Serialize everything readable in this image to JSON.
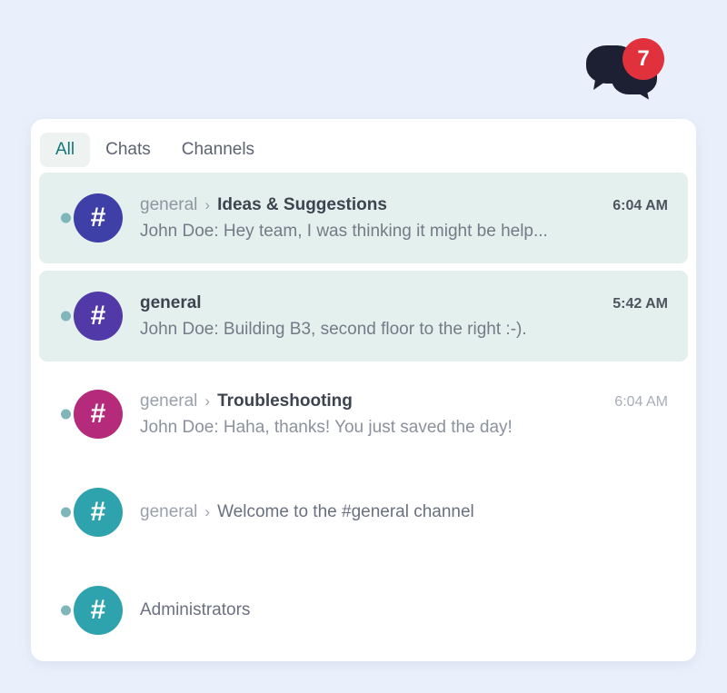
{
  "notification": {
    "icon": "chat-bubbles-icon",
    "badge_count": "7",
    "badge_color": "#e0313c",
    "icon_color": "#1d2033"
  },
  "tabs": [
    {
      "label": "All",
      "active": true
    },
    {
      "label": "Chats",
      "active": false
    },
    {
      "label": "Channels",
      "active": false
    }
  ],
  "rows": [
    {
      "avatar_glyph": "#",
      "avatar_color": "#3f3fa8",
      "unread": true,
      "highlighted": true,
      "parent": "general",
      "separator": "›",
      "title": "Ideas & Suggestions",
      "title_bold": true,
      "time": "6:04 AM",
      "preview": "John Doe: Hey team, I was thinking it might be help..."
    },
    {
      "avatar_glyph": "#",
      "avatar_color": "#5239a8",
      "unread": true,
      "highlighted": true,
      "parent": "",
      "separator": "",
      "title": "general",
      "title_bold": true,
      "time": "5:42 AM",
      "preview": "John Doe: Building B3, second floor to the right :-)."
    },
    {
      "avatar_glyph": "#",
      "avatar_color": "#b52a7a",
      "unread": true,
      "highlighted": false,
      "parent": "general",
      "separator": "›",
      "title": "Troubleshooting",
      "title_bold": true,
      "time": "6:04 AM",
      "preview": "John Doe: Haha, thanks! You just saved the day!"
    },
    {
      "avatar_glyph": "#",
      "avatar_color": "#2fa3ad",
      "unread": true,
      "highlighted": false,
      "parent": "general",
      "separator": "›",
      "title": "Welcome to the #general channel",
      "title_bold": false,
      "time": "",
      "preview": ""
    },
    {
      "avatar_glyph": "#",
      "avatar_color": "#2fa3ad",
      "unread": true,
      "highlighted": false,
      "parent": "",
      "separator": "",
      "title": "Administrators",
      "title_bold": false,
      "time": "",
      "preview": ""
    }
  ],
  "theme": {
    "page_background": "#eaf0fb",
    "card_background": "#ffffff",
    "highlight_background": "#e4f0ee",
    "active_tab_background": "#eef2f1",
    "active_tab_color": "#16757a",
    "unread_dot_color": "#7fb5bb"
  }
}
